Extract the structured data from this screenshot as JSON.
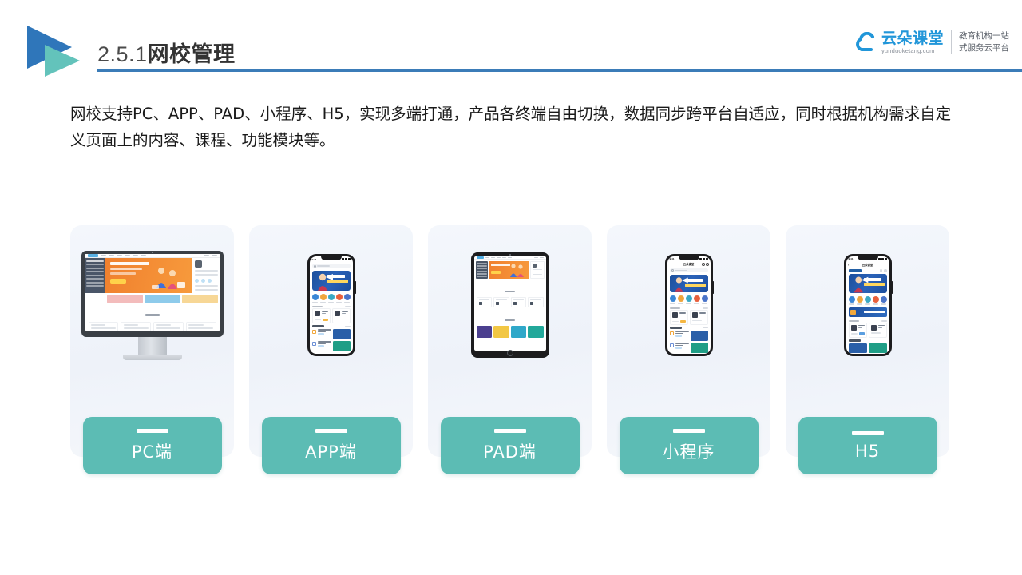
{
  "header": {
    "section_number": "2.5.1",
    "title_cn": "网校管理",
    "logo_icon": "play-triangle-logo",
    "rule_color": "#3b7cb8"
  },
  "brand": {
    "icon": "cloud-icon",
    "name_cn": "云朵课堂",
    "url": "yunduoketang.com",
    "tagline_line1": "教育机构一站",
    "tagline_line2": "式服务云平台",
    "color": "#2196d9"
  },
  "body_copy": {
    "line1": "网校支持PC、APP、PAD、小程序、H5，实现多端打通，产品各终端自由切换，数据同步跨平台自适应，同时根据机构",
    "line2": "需求自定义页面上的内容、课程、功能模块等。"
  },
  "theme": {
    "accent_teal": "#5cbcb4",
    "card_bg": "#f1f5fb",
    "title_blue": "#3b7cb8",
    "banner_orange": "#f0802e",
    "banner_blue": "#1d4f9e"
  },
  "cards": [
    {
      "id": "pc",
      "device": "desktop-monitor",
      "label": "PC端"
    },
    {
      "id": "app",
      "device": "smartphone",
      "label": "APP端"
    },
    {
      "id": "pad",
      "device": "tablet",
      "label": "PAD端"
    },
    {
      "id": "mini",
      "device": "smartphone",
      "label": "小程序"
    },
    {
      "id": "h5",
      "device": "smartphone",
      "label": "H5"
    }
  ],
  "device_mock": {
    "phone_status_time": "9:41",
    "mini_program_title": "云朵课堂",
    "h5_title": "云朵课堂",
    "hero_headline": "职场人的第一堂写作课",
    "icon_colors": [
      "#3a86d6",
      "#f0a63c",
      "#3aa9c4",
      "#e8603c",
      "#4a74c9"
    ],
    "tablet_grid_colors": [
      "#4b3f8f",
      "#f2c744",
      "#2fa8c9",
      "#22a89a",
      "#2f4b7c",
      "#ef8733",
      "#3d4756",
      "#2f7fd4",
      "#f2c744",
      "#2fa8c9",
      "#2aa86e",
      "#ef8733"
    ],
    "pc_promo_colors": [
      "#f2b8b8",
      "#7fc4e8",
      "#f6d48a"
    ],
    "h5_bottom_colors": [
      "#2a5fa8",
      "#1f9e86"
    ]
  }
}
